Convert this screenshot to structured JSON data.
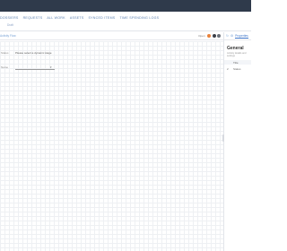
{
  "nav": {
    "tabs": [
      "DOSSIERS",
      "REQUESTS",
      "ALL WORK",
      "ASSETS",
      "SYNCED ITEMS",
      "TIME SPENDING LOGS"
    ],
    "sub_label": "Draft"
  },
  "toolbar": {
    "breadcrumb": "Activity Flow",
    "status_text": "Open",
    "colors": {
      "dot1": "#e8823a",
      "dot2": "#3a3f48",
      "dot3": "#6a6f78"
    }
  },
  "form": {
    "status_label": "Status",
    "status_value": "Please select a dynamic stage",
    "field2_label": "Name",
    "caret": "▾"
  },
  "panel": {
    "icon1": "↻",
    "icon2": "⚙",
    "active_tab": "Properties",
    "title": "General",
    "subtitle": "Activity details and settings",
    "row1": "Title",
    "row2": "Status",
    "row1_num": "1",
    "row2_num": "2"
  }
}
